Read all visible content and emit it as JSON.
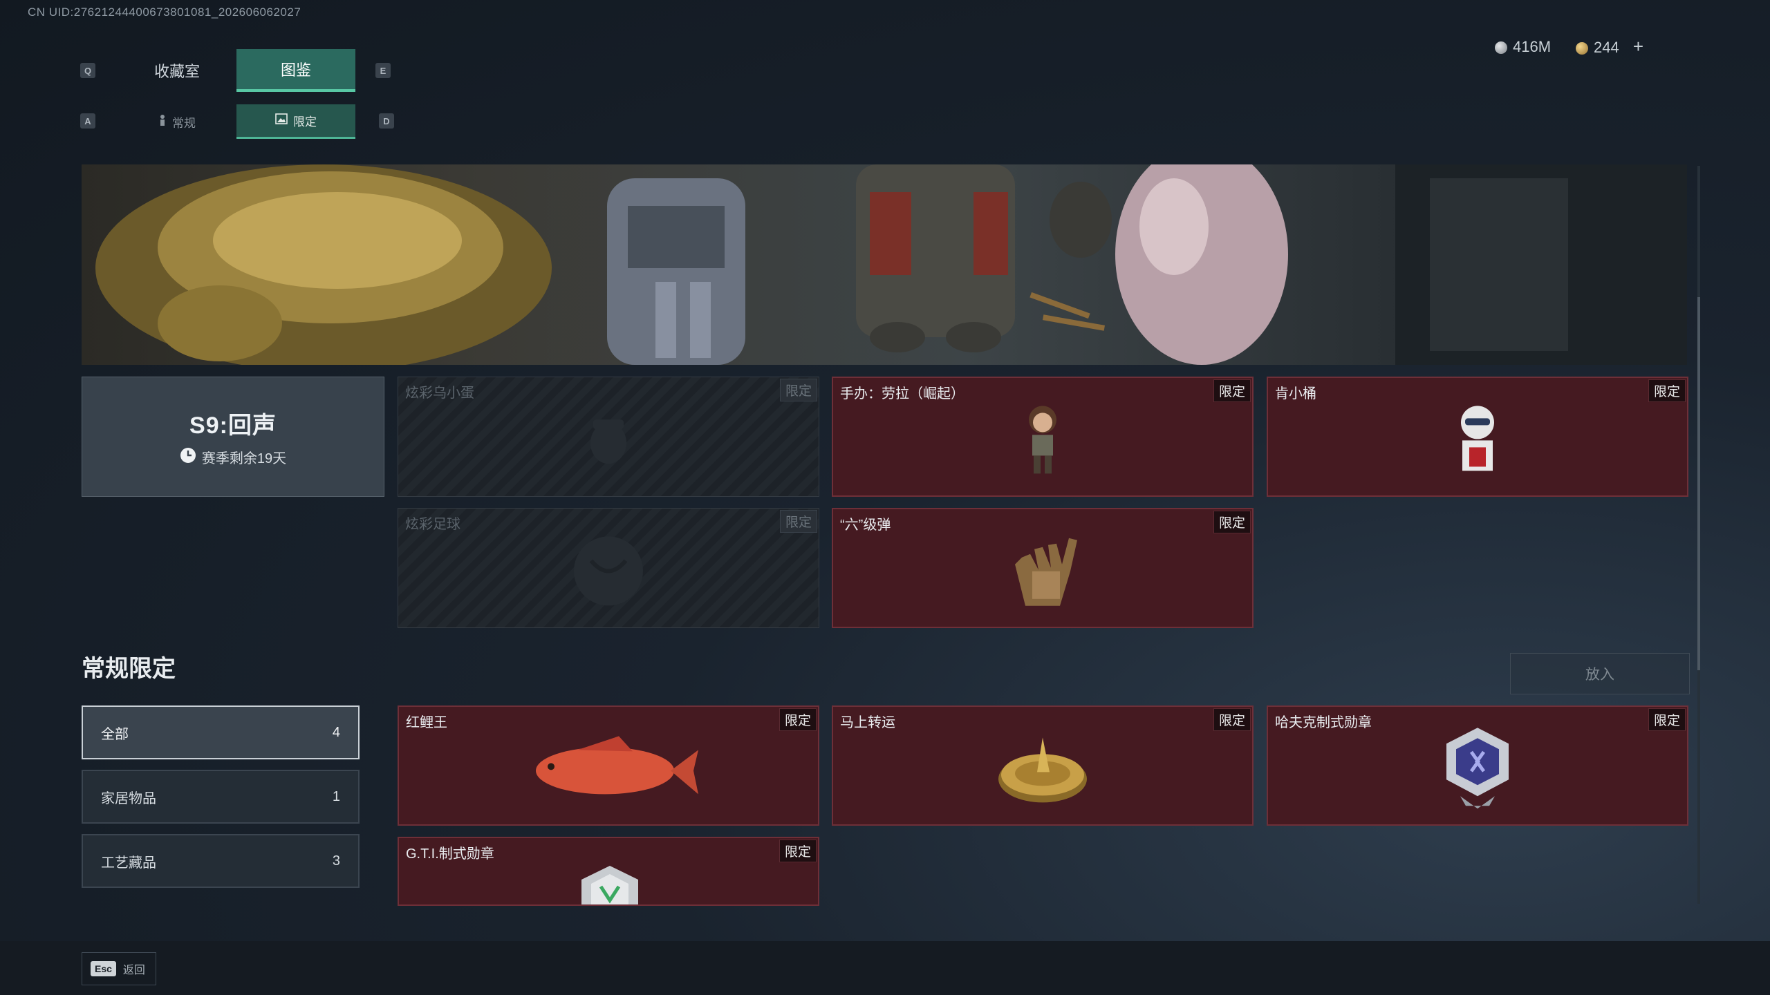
{
  "uid": "CN UID:27621244400673801081_202606062027",
  "tabs": {
    "prev_key": "Q",
    "next_key": "E",
    "items": [
      {
        "label": "收藏室"
      },
      {
        "label": "图鉴"
      }
    ]
  },
  "subtabs": {
    "prev_key": "A",
    "next_key": "D",
    "items": [
      {
        "label": "常规",
        "icon": "figure-icon"
      },
      {
        "label": "限定",
        "icon": "image-icon"
      }
    ]
  },
  "currency": {
    "silver": "416M",
    "gold": "244",
    "add": "+"
  },
  "season": {
    "title": "S9:回声",
    "remaining": "赛季剩余19天"
  },
  "season_items": [
    {
      "name": "炫彩乌小蛋",
      "badge": "限定",
      "locked": true
    },
    {
      "name": "手办：劳拉（崛起）",
      "badge": "限定",
      "locked": false
    },
    {
      "name": "肯小桶",
      "badge": "限定",
      "locked": false
    },
    {
      "name": "炫彩足球",
      "badge": "限定",
      "locked": true
    },
    {
      "name": "“六”级弹",
      "badge": "限定",
      "locked": false
    }
  ],
  "regular": {
    "title": "常规限定",
    "put_button": "放入",
    "filters": [
      {
        "label": "全部",
        "count": "4"
      },
      {
        "label": "家居物品",
        "count": "1"
      },
      {
        "label": "工艺藏品",
        "count": "3"
      }
    ],
    "items": [
      {
        "name": "红鲤王",
        "badge": "限定"
      },
      {
        "name": "马上转运",
        "badge": "限定"
      },
      {
        "name": "哈夫克制式勋章",
        "badge": "限定"
      },
      {
        "name": "G.T.I.制式勋章",
        "badge": "限定"
      }
    ]
  },
  "footer": {
    "esc_key": "Esc",
    "back_label": "返回"
  },
  "colors": {
    "accent": "#2b6a5f",
    "card_bg": "#451a21",
    "panel_bg": "#38424c"
  }
}
